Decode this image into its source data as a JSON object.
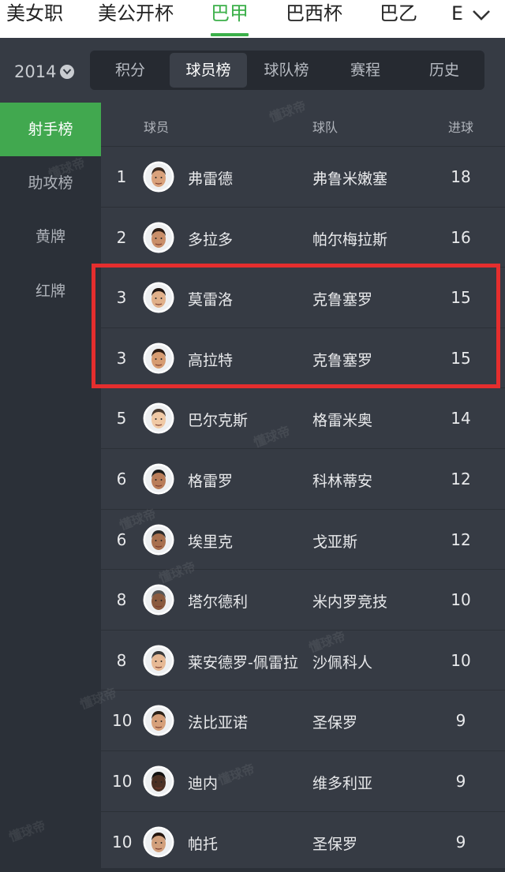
{
  "league_tabs": [
    {
      "label": "美女职",
      "active": false
    },
    {
      "label": "美公开杯",
      "active": false
    },
    {
      "label": "巴甲",
      "active": true
    },
    {
      "label": "巴西杯",
      "active": false
    },
    {
      "label": "巴乙",
      "active": false
    },
    {
      "label": "E",
      "active": false
    }
  ],
  "season": {
    "label": "2014"
  },
  "segments": [
    {
      "label": "积分",
      "active": false
    },
    {
      "label": "球员榜",
      "active": true
    },
    {
      "label": "球队榜",
      "active": false
    },
    {
      "label": "赛程",
      "active": false
    },
    {
      "label": "历史",
      "active": false
    }
  ],
  "sidebar": [
    {
      "label": "射手榜",
      "active": true
    },
    {
      "label": "助攻榜",
      "active": false
    },
    {
      "label": "黄牌",
      "active": false
    },
    {
      "label": "红牌",
      "active": false
    }
  ],
  "table": {
    "headers": {
      "player": "球员",
      "team": "球队",
      "goals": "进球"
    },
    "rows": [
      {
        "rank": "1",
        "name": "弗雷德",
        "team": "弗鲁米嫩塞",
        "goals": "18"
      },
      {
        "rank": "2",
        "name": "多拉多",
        "team": "帕尔梅拉斯",
        "goals": "16"
      },
      {
        "rank": "3",
        "name": "莫雷洛",
        "team": "克鲁塞罗",
        "goals": "15"
      },
      {
        "rank": "3",
        "name": "高拉特",
        "team": "克鲁塞罗",
        "goals": "15"
      },
      {
        "rank": "5",
        "name": "巴尔克斯",
        "team": "格雷米奥",
        "goals": "14"
      },
      {
        "rank": "6",
        "name": "格雷罗",
        "team": "科林蒂安",
        "goals": "12"
      },
      {
        "rank": "6",
        "name": "埃里克",
        "team": "戈亚斯",
        "goals": "12"
      },
      {
        "rank": "8",
        "name": "塔尔德利",
        "team": "米内罗竞技",
        "goals": "10"
      },
      {
        "rank": "8",
        "name": "莱安德罗-佩雷拉",
        "team": "沙佩科人",
        "goals": "10"
      },
      {
        "rank": "10",
        "name": "法比亚诺",
        "team": "圣保罗",
        "goals": "9"
      },
      {
        "rank": "10",
        "name": "迪内",
        "team": "维多利亚",
        "goals": "9"
      },
      {
        "rank": "10",
        "name": "帕托",
        "team": "圣保罗",
        "goals": "9"
      }
    ]
  },
  "watermark": "懂球帝",
  "colors": {
    "accent": "#3cb04a",
    "highlight_border": "#e52e2e"
  }
}
